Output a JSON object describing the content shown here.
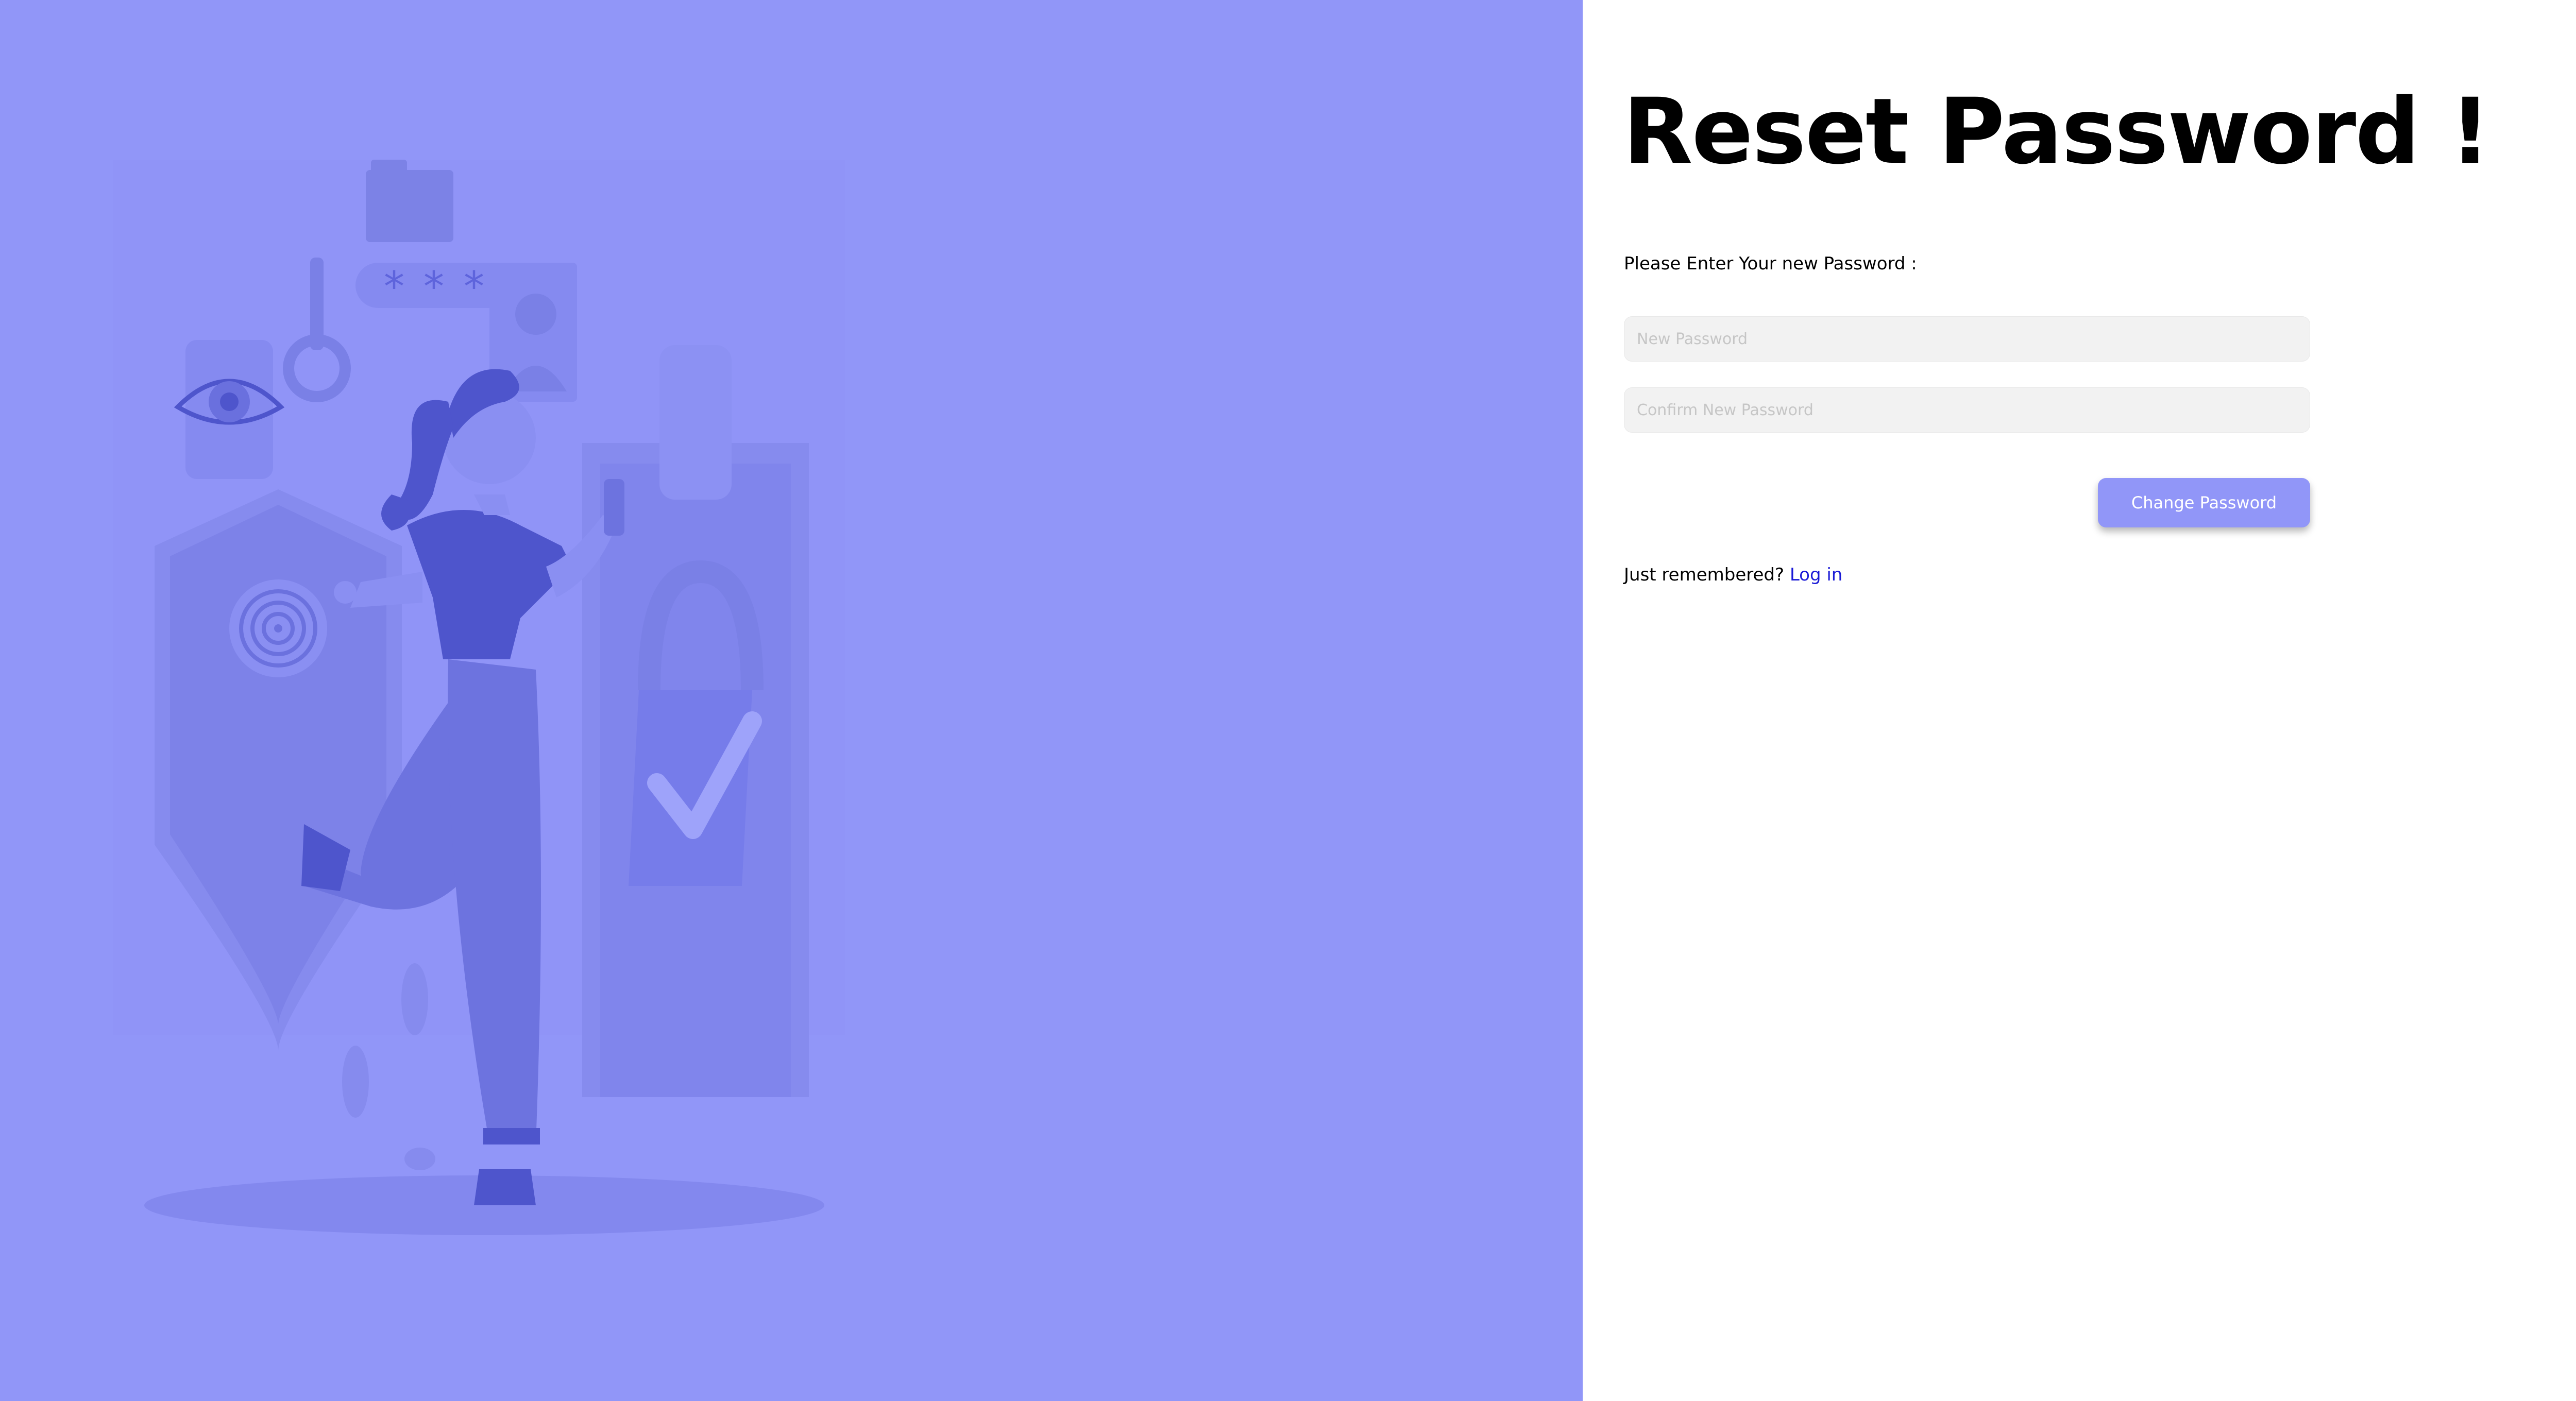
{
  "illustration": {
    "semantic": "woman-security-illustration",
    "background_color": "#9196f8",
    "accent_color": "#5057d0"
  },
  "form": {
    "title": "Reset Password !",
    "prompt": "Please Enter Your new Password :",
    "new_password": {
      "value": "",
      "placeholder": "New Password"
    },
    "confirm_password": {
      "value": "",
      "placeholder": "Confirm New Password"
    },
    "submit_label": "Change Password",
    "submit_color": "#9196f8",
    "remember_text": "Just remembered?",
    "login_link": "Log in",
    "link_color": "#1a1ad6"
  }
}
